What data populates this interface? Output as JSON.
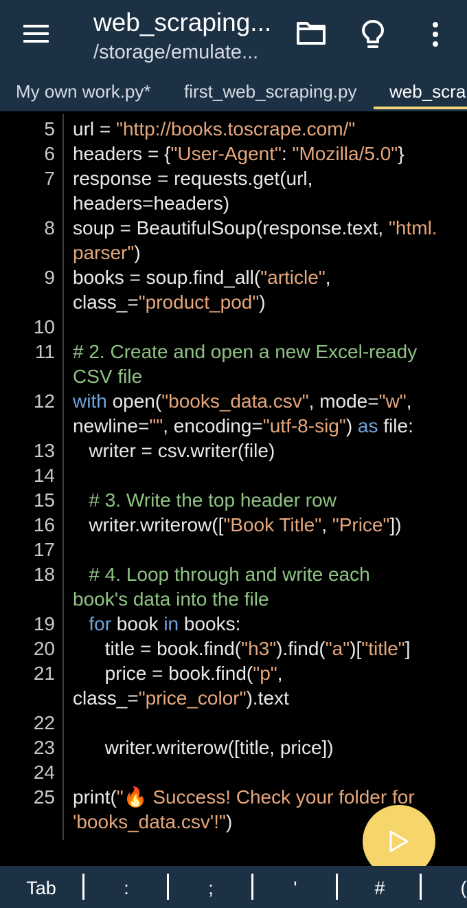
{
  "appbar": {
    "title": "web_scraping...",
    "subtitle": "/storage/emulate...",
    "menu_icon": "hamburger-icon",
    "folder_icon": "folder-icon",
    "hint_icon": "lightbulb-icon",
    "more_icon": "more-vertical-icon"
  },
  "tabs": [
    {
      "label": "My own work.py*"
    },
    {
      "label": "first_web_scraping.py"
    },
    {
      "label": "web_scrap"
    }
  ],
  "code": {
    "lines": [
      {
        "num": "5",
        "segs": [
          {
            "t": "url = "
          },
          {
            "t": "\"http://books.toscrape.com/\"",
            "c": "s"
          }
        ]
      },
      {
        "num": "6",
        "segs": [
          {
            "t": "headers = {"
          },
          {
            "t": "\"User-Agent\"",
            "c": "s"
          },
          {
            "t": ": "
          },
          {
            "t": "\"Mozilla/5.0\"",
            "c": "s"
          },
          {
            "t": "}"
          }
        ]
      },
      {
        "num": "7",
        "segs": [
          {
            "t": "response = requests.get(url,"
          }
        ]
      },
      {
        "num": "",
        "segs": [
          {
            "t": "headers=headers)"
          }
        ]
      },
      {
        "num": "8",
        "segs": [
          {
            "t": "soup = BeautifulSoup(response.text, "
          },
          {
            "t": "\"html.",
            "c": "s"
          }
        ]
      },
      {
        "num": "",
        "segs": [
          {
            "t": "parser\"",
            "c": "s"
          },
          {
            "t": ")"
          }
        ]
      },
      {
        "num": "9",
        "segs": [
          {
            "t": "books = soup.find_all("
          },
          {
            "t": "\"article\"",
            "c": "s"
          },
          {
            "t": ","
          }
        ]
      },
      {
        "num": "",
        "segs": [
          {
            "t": "class_="
          },
          {
            "t": "\"product_pod\"",
            "c": "s"
          },
          {
            "t": ")"
          }
        ]
      },
      {
        "num": "10",
        "segs": []
      },
      {
        "num": "11",
        "segs": [
          {
            "t": "# 2. Create and open a new Excel-ready",
            "c": "c"
          }
        ]
      },
      {
        "num": "",
        "segs": [
          {
            "t": "CSV file",
            "c": "c"
          }
        ]
      },
      {
        "num": "12",
        "segs": [
          {
            "t": "with",
            "c": "k"
          },
          {
            "t": " open("
          },
          {
            "t": "\"books_data.csv\"",
            "c": "s"
          },
          {
            "t": ", mode="
          },
          {
            "t": "\"w\"",
            "c": "s"
          },
          {
            "t": ","
          }
        ]
      },
      {
        "num": "",
        "segs": [
          {
            "t": "newline="
          },
          {
            "t": "\"\"",
            "c": "s"
          },
          {
            "t": ", encoding="
          },
          {
            "t": "\"utf-8-sig\"",
            "c": "s"
          },
          {
            "t": ") "
          },
          {
            "t": "as",
            "c": "k"
          },
          {
            "t": " file:"
          }
        ]
      },
      {
        "num": "13",
        "segs": [
          {
            "t": "   writer = csv.writer(file)"
          }
        ]
      },
      {
        "num": "14",
        "segs": []
      },
      {
        "num": "15",
        "segs": [
          {
            "t": "   "
          },
          {
            "t": "# 3. Write the top header row",
            "c": "c"
          }
        ]
      },
      {
        "num": "16",
        "segs": [
          {
            "t": "   writer.writerow(["
          },
          {
            "t": "\"Book Title\"",
            "c": "s"
          },
          {
            "t": ", "
          },
          {
            "t": "\"Price\"",
            "c": "s"
          },
          {
            "t": "])"
          }
        ]
      },
      {
        "num": "17",
        "segs": []
      },
      {
        "num": "18",
        "segs": [
          {
            "t": "   "
          },
          {
            "t": "# 4. Loop through and write each",
            "c": "c"
          }
        ]
      },
      {
        "num": "",
        "segs": [
          {
            "t": "book's data into the file",
            "c": "c"
          }
        ]
      },
      {
        "num": "19",
        "segs": [
          {
            "t": "   "
          },
          {
            "t": "for",
            "c": "k"
          },
          {
            "t": " book "
          },
          {
            "t": "in",
            "c": "k"
          },
          {
            "t": " books:"
          }
        ]
      },
      {
        "num": "20",
        "segs": [
          {
            "t": "      title = book.find("
          },
          {
            "t": "\"h3\"",
            "c": "s"
          },
          {
            "t": ").find("
          },
          {
            "t": "\"a\"",
            "c": "s"
          },
          {
            "t": ")["
          },
          {
            "t": "\"title\"",
            "c": "s"
          },
          {
            "t": "]"
          }
        ]
      },
      {
        "num": "21",
        "segs": [
          {
            "t": "      price = book.find("
          },
          {
            "t": "\"p\"",
            "c": "s"
          },
          {
            "t": ","
          }
        ]
      },
      {
        "num": "",
        "segs": [
          {
            "t": "class_="
          },
          {
            "t": "\"price_color\"",
            "c": "s"
          },
          {
            "t": ").text"
          }
        ]
      },
      {
        "num": "22",
        "segs": []
      },
      {
        "num": "23",
        "segs": [
          {
            "t": "      writer.writerow([title, price])"
          }
        ]
      },
      {
        "num": "24",
        "segs": []
      },
      {
        "num": "25",
        "segs": [
          {
            "t": "print("
          },
          {
            "t": "\"🔥 Success! Check your folder for",
            "c": "s"
          }
        ]
      },
      {
        "num": "",
        "segs": [
          {
            "t": "'books_data.csv'!\"",
            "c": "s"
          },
          {
            "t": ")"
          }
        ]
      }
    ]
  },
  "fab": {
    "icon": "play-icon"
  },
  "keybar": {
    "keys": [
      {
        "label": "Tab"
      },
      {
        "label": ":"
      },
      {
        "label": ";"
      },
      {
        "label": "'"
      },
      {
        "label": "#"
      },
      {
        "label": "("
      }
    ]
  }
}
